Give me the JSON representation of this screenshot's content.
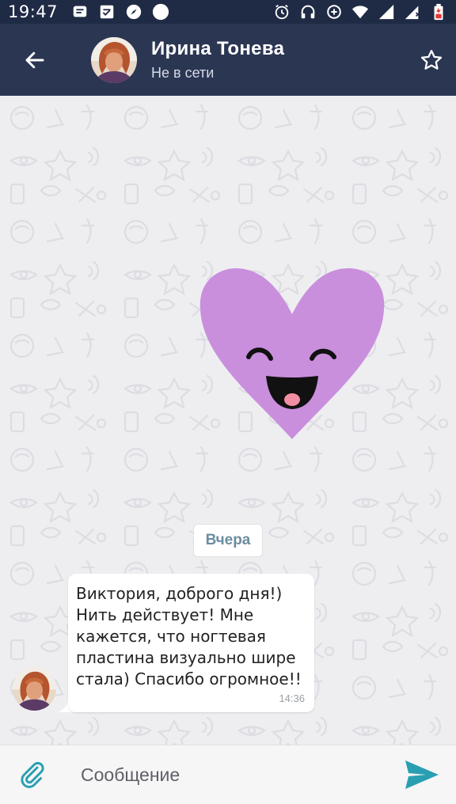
{
  "status_bar": {
    "time": "19:47",
    "left_icons": [
      "message-icon",
      "checklist-icon",
      "compass-icon",
      "circle-icon"
    ],
    "right_icons": [
      "alarm-icon",
      "headset-icon",
      "data-saver-icon",
      "wifi-icon",
      "signal-icon",
      "signal-alt-icon",
      "battery-icon"
    ]
  },
  "header": {
    "contact_name": "Ирина Тонева",
    "contact_status": "Не в сети"
  },
  "chat": {
    "date_label": "Вчера",
    "message": {
      "text": "Виктория, доброго дня!) Нить действует! Мне кажется, что ногтевая пластина визуально шире стала) Спасибо огромное!!",
      "time": "14:36"
    }
  },
  "composer": {
    "placeholder": "Сообщение"
  },
  "colors": {
    "status_bar": "#1f2a45",
    "app_bar": "#2b3653",
    "heart": "#c98fdc",
    "send": "#2a9fb1",
    "date_text": "#6b8da0"
  }
}
